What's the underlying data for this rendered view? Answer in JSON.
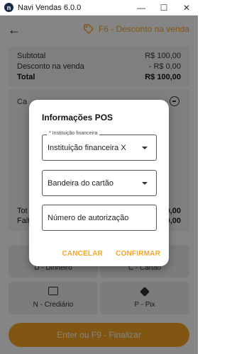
{
  "window": {
    "title": "Navi Vendas 6.0.0",
    "icon_letter": "n",
    "minimize": "—",
    "maximize": "☐",
    "close": "✕"
  },
  "header": {
    "action_label": "F6 - Desconto na venda",
    "accent": "#f5a623"
  },
  "summary": {
    "rows": [
      {
        "label": "Subtotal",
        "value": "R$ 100,00"
      },
      {
        "label": "Desconto na venda",
        "value": "- R$ 0,00"
      },
      {
        "label": "Total",
        "value": "R$ 100,00"
      }
    ]
  },
  "payments": {
    "label_partial": "Ca",
    "footer_rows": [
      {
        "label": "Tot",
        "value": "0,00"
      },
      {
        "label": "Falt",
        "value": "0,00"
      }
    ]
  },
  "methods": [
    {
      "label": "D - Dinheiro",
      "icon": "cash-icon"
    },
    {
      "label": "C - Cartão",
      "icon": "card-icon"
    },
    {
      "label": "N - Crediário",
      "icon": "calculator-icon"
    },
    {
      "label": "P - Pix",
      "icon": "pix-icon"
    }
  ],
  "finalize_label": "Enter ou F9 - Finalizar",
  "dialog": {
    "title": "Informações POS",
    "institution": {
      "legend": "* Instituição financeira",
      "value": "Instituição financeira X"
    },
    "brand": {
      "value": "Bandeira do cartão"
    },
    "authorization": {
      "placeholder": "Número de autorização"
    },
    "cancel_label": "CANCELAR",
    "confirm_label": "CONFIRMAR"
  }
}
